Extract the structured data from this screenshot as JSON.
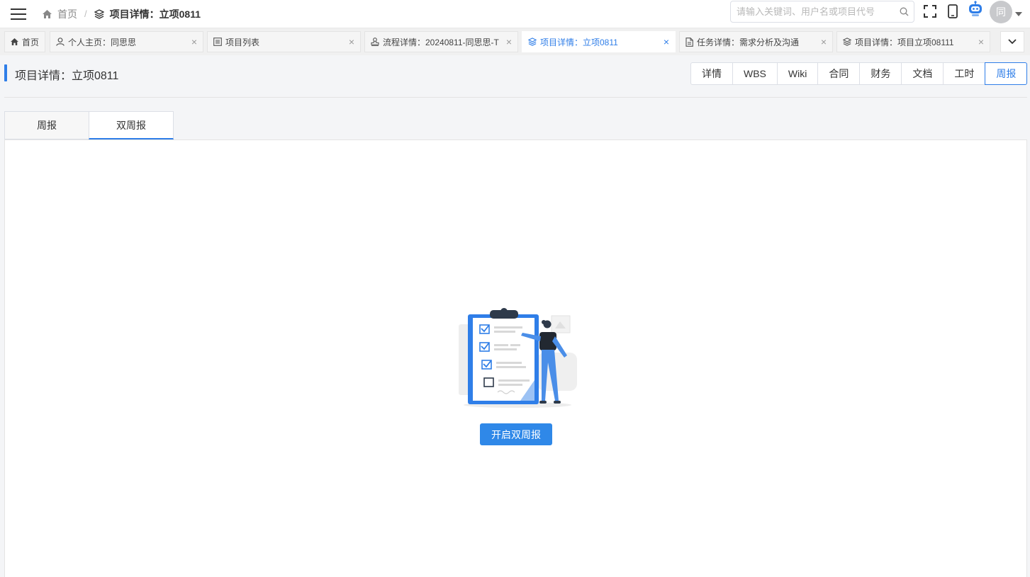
{
  "header": {
    "breadcrumb": {
      "home": "首页",
      "separator": "/",
      "current": "项目详情：立项0811"
    },
    "search": {
      "placeholder": "请输入关键词、用户名或项目代号",
      "value": ""
    },
    "avatar_text": "同"
  },
  "tabs": [
    {
      "label": "首页",
      "icon": "home-icon",
      "closable": false,
      "active": false
    },
    {
      "label": "个人主页：同思思",
      "icon": "user-icon",
      "closable": true,
      "active": false
    },
    {
      "label": "项目列表",
      "icon": "list-icon",
      "closable": true,
      "active": false
    },
    {
      "label": "流程详情：20240811-同思思-T",
      "icon": "stamp-icon",
      "closable": true,
      "active": false
    },
    {
      "label": "项目详情：立项0811",
      "icon": "layers-icon",
      "closable": true,
      "active": true
    },
    {
      "label": "任务详情：需求分析及沟通",
      "icon": "file-icon",
      "closable": true,
      "active": false
    },
    {
      "label": "项目详情：项目立项08111",
      "icon": "layers-icon",
      "closable": true,
      "active": false
    }
  ],
  "page": {
    "title": "项目详情：立项0811",
    "sections": [
      "详情",
      "WBS",
      "Wiki",
      "合同",
      "财务",
      "文档",
      "工时",
      "周报"
    ],
    "active_section": "周报",
    "report_tabs": [
      "周报",
      "双周报"
    ],
    "active_report_tab": "双周报",
    "empty_action_label": "开启双周报"
  },
  "colors": {
    "primary": "#2f7ee8",
    "button": "#2f88e8"
  }
}
